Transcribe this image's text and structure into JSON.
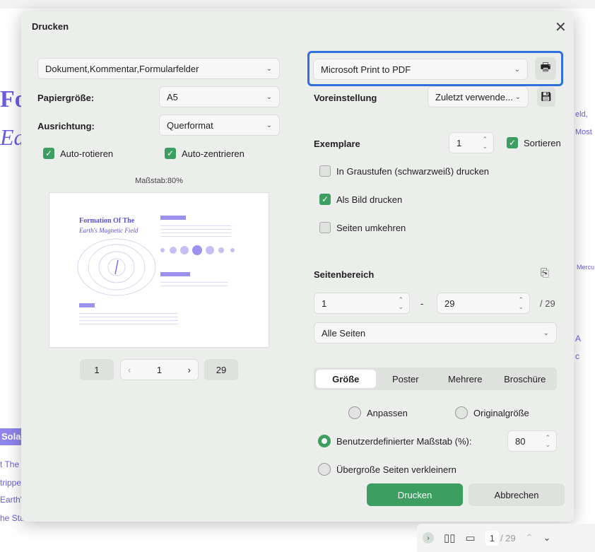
{
  "background": {
    "left": [
      "Fo",
      "Ear",
      "Sola",
      "t The",
      "trippe",
      "Earth's",
      "he Sta"
    ],
    "right": [
      "eld,",
      "Most",
      "Mercu",
      "A",
      "c"
    ]
  },
  "dialog": {
    "title": "Drucken"
  },
  "left": {
    "content_select": "Dokument,Kommentar,Formularfelder",
    "paper_label": "Papiergröße:",
    "paper_value": "A5",
    "orient_label": "Ausrichtung:",
    "orient_value": "Querformat",
    "auto_rotate": "Auto-rotieren",
    "auto_center": "Auto-zentrieren",
    "scale_label": "Maßstab:80%",
    "preview": {
      "title1": "Formation Of The",
      "title2": "Earth's Magnetic Field"
    },
    "pager": {
      "first": "1",
      "current": "1",
      "last": "29"
    }
  },
  "right": {
    "printer": "Microsoft Print to PDF",
    "preset_label": "Voreinstellung",
    "preset_value": "Zuletzt verwende...",
    "copies_label": "Exemplare",
    "copies": "1",
    "sort": "Sortieren",
    "grayscale": "In Graustufen (schwarzweiß) drucken",
    "as_image": "Als Bild drucken",
    "reverse": "Seiten umkehren",
    "range_label": "Seitenbereich",
    "from": "1",
    "dash": "-",
    "to": "29",
    "total": "/ 29",
    "range_select": "Alle Seiten",
    "tabs": [
      "Größe",
      "Poster",
      "Mehrere",
      "Broschüre"
    ],
    "fit": "Anpassen",
    "original": "Originalgröße",
    "custom": "Benutzerdefinierter Maßstab (%):",
    "custom_value": "80",
    "shrink": "Übergroße Seiten verkleinern",
    "print": "Drucken",
    "cancel": "Abbrechen"
  },
  "bottombar": {
    "page": "1",
    "total": "/ 29"
  },
  "colors": {
    "accent": "#3e9e62",
    "focus": "#2f6fe0"
  }
}
